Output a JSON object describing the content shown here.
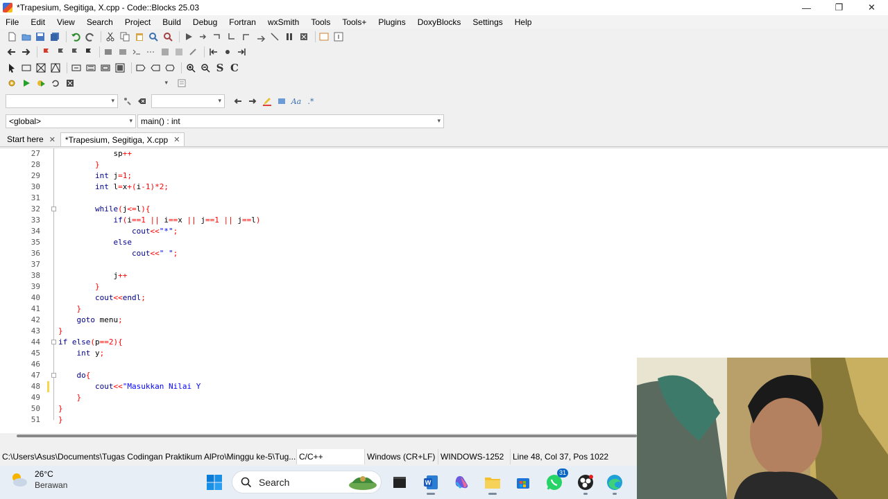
{
  "window": {
    "title": "*Trapesium, Segitiga, X.cpp - Code::Blocks 25.03",
    "minimize_glyph": "—",
    "restore_glyph": "❐",
    "close_glyph": "✕"
  },
  "menu": [
    "File",
    "Edit",
    "View",
    "Search",
    "Project",
    "Build",
    "Debug",
    "Fortran",
    "wxSmith",
    "Tools",
    "Tools+",
    "Plugins",
    "DoxyBlocks",
    "Settings",
    "Help"
  ],
  "scope": {
    "global_value": "<global>",
    "function_value": "main() : int"
  },
  "tabs": [
    {
      "label": "Start here",
      "active": false
    },
    {
      "label": "*Trapesium, Segitiga, X.cpp",
      "active": true
    }
  ],
  "editor": {
    "lines": [
      {
        "n": "27",
        "text": "            sp++"
      },
      {
        "n": "28",
        "text": "        }"
      },
      {
        "n": "29",
        "text": "        int j=1;"
      },
      {
        "n": "30",
        "text": "        int l=x+(i-1)*2;"
      },
      {
        "n": "31",
        "text": ""
      },
      {
        "n": "32",
        "text": "        while(j<=l){"
      },
      {
        "n": "33",
        "text": "            if(i==1 || i==x || j==1 || j==l)"
      },
      {
        "n": "34",
        "text": "                cout<<\"*\";"
      },
      {
        "n": "35",
        "text": "            else"
      },
      {
        "n": "36",
        "text": "                cout<<\" \";"
      },
      {
        "n": "37",
        "text": ""
      },
      {
        "n": "38",
        "text": "            j++"
      },
      {
        "n": "39",
        "text": "        }"
      },
      {
        "n": "40",
        "text": "        cout<<endl;"
      },
      {
        "n": "41",
        "text": "    }"
      },
      {
        "n": "42",
        "text": "    goto menu;"
      },
      {
        "n": "43",
        "text": "}"
      },
      {
        "n": "44",
        "text": "if else(p==2){"
      },
      {
        "n": "45",
        "text": "    int y;"
      },
      {
        "n": "46",
        "text": ""
      },
      {
        "n": "47",
        "text": "    do{"
      },
      {
        "n": "48",
        "text": "        cout<<\"Masukkan Nilai Y"
      },
      {
        "n": "49",
        "text": "    }"
      },
      {
        "n": "50",
        "text": "}"
      },
      {
        "n": "51",
        "text": "}"
      }
    ]
  },
  "status": {
    "path": "C:\\Users\\Asus\\Documents\\Tugas Codingan Praktikum AlPro\\Minggu ke-5\\Tug...",
    "language": "C/C++",
    "eol": "Windows (CR+LF)",
    "encoding": "WINDOWS-1252",
    "position": "Line 48, Col 37, Pos 1022"
  },
  "taskbar": {
    "temperature": "26°C",
    "weather": "Berawan",
    "search_label": "Search",
    "whatsapp_badge": "31"
  },
  "colors": {
    "keyword": "#00008b",
    "operator": "#ff0000",
    "string": "#0000ff",
    "accent": "#0078d4"
  }
}
